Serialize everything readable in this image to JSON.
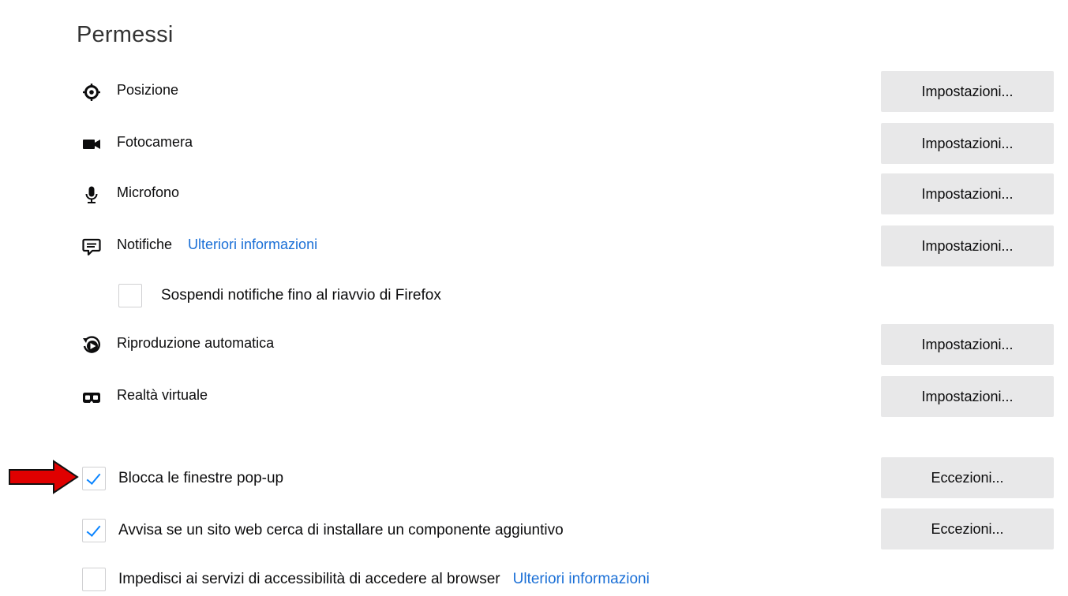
{
  "section": {
    "title": "Permessi"
  },
  "permissions": [
    {
      "icon": "location-icon",
      "label": "Posizione",
      "button": "Impostazioni..."
    },
    {
      "icon": "camera-icon",
      "label": "Fotocamera",
      "button": "Impostazioni..."
    },
    {
      "icon": "microphone-icon",
      "label": "Microfono",
      "button": "Impostazioni..."
    },
    {
      "icon": "notification-icon",
      "label": "Notifiche",
      "link": "Ulteriori informazioni",
      "button": "Impostazioni..."
    },
    {
      "icon": "autoplay-icon",
      "label": "Riproduzione automatica",
      "button": "Impostazioni..."
    },
    {
      "icon": "vr-icon",
      "label": "Realtà virtuale",
      "button": "Impostazioni..."
    }
  ],
  "suspend_notifications": {
    "label": "Sospendi notifiche fino al riavvio di Firefox",
    "checked": false
  },
  "block_popups": {
    "label": "Blocca le finestre pop-up",
    "checked": true,
    "button": "Eccezioni..."
  },
  "warn_addons": {
    "label": "Avvisa se un sito web cerca di installare un componente aggiuntivo",
    "checked": true,
    "button": "Eccezioni..."
  },
  "block_accessibility": {
    "label": "Impedisci ai servizi di accessibilità di accedere al browser",
    "link": "Ulteriori informazioni",
    "checked": false
  },
  "colors": {
    "accent": "#0a84ff",
    "link": "#1a6fd6",
    "button_bg": "#e8e8e9",
    "annotation_arrow": "#e00000"
  }
}
